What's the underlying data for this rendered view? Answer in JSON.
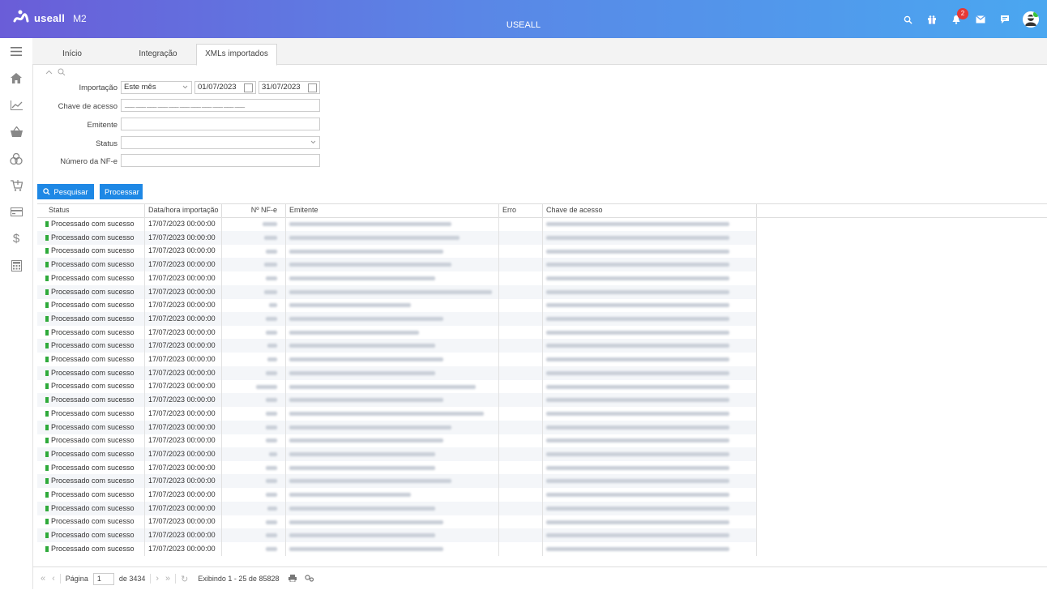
{
  "header": {
    "brand": "useall",
    "version": "M2",
    "title": "USEALL",
    "notification_count": "2",
    "icons": [
      "search-icon",
      "gift-icon",
      "bell-icon",
      "mail-icon",
      "chat-icon",
      "avatar"
    ]
  },
  "sidebar": {
    "items": [
      "menu-icon",
      "home-icon",
      "chart-icon",
      "basket-icon",
      "boxes-icon",
      "cart-icon",
      "card-icon",
      "dollar-icon",
      "calculator-icon"
    ]
  },
  "tabs": [
    {
      "label": "Início"
    },
    {
      "label": "Integração"
    },
    {
      "label": "XMLs importados",
      "active": true
    }
  ],
  "filters": {
    "importacao_label": "Importação",
    "importacao_value": "Este mês",
    "date_from": "01/07/2023",
    "date_to": "31/07/2023",
    "chave_label": "Chave de acesso",
    "chave_mask": "___ ___ ___ ___ ___ ___ ___ ___ ___ ___ ___",
    "emitente_label": "Emitente",
    "status_label": "Status",
    "numero_label": "Número da NF-e"
  },
  "actions": {
    "search_label": "Pesquisar",
    "process_label": "Processar"
  },
  "grid": {
    "columns": [
      "Status",
      "Data/hora importação",
      "Nº NF-e",
      "Emitente",
      "Erro",
      "Chave de acesso"
    ],
    "rows": [
      {
        "status": "Processado com sucesso",
        "date": "17/07/2023 00:00:00"
      },
      {
        "status": "Processado com sucesso",
        "date": "17/07/2023 00:00:00"
      },
      {
        "status": "Processado com sucesso",
        "date": "17/07/2023 00:00:00"
      },
      {
        "status": "Processado com sucesso",
        "date": "17/07/2023 00:00:00"
      },
      {
        "status": "Processado com sucesso",
        "date": "17/07/2023 00:00:00"
      },
      {
        "status": "Processado com sucesso",
        "date": "17/07/2023 00:00:00"
      },
      {
        "status": "Processado com sucesso",
        "date": "17/07/2023 00:00:00"
      },
      {
        "status": "Processado com sucesso",
        "date": "17/07/2023 00:00:00"
      },
      {
        "status": "Processado com sucesso",
        "date": "17/07/2023 00:00:00"
      },
      {
        "status": "Processado com sucesso",
        "date": "17/07/2023 00:00:00"
      },
      {
        "status": "Processado com sucesso",
        "date": "17/07/2023 00:00:00"
      },
      {
        "status": "Processado com sucesso",
        "date": "17/07/2023 00:00:00"
      },
      {
        "status": "Processado com sucesso",
        "date": "17/07/2023 00:00:00"
      },
      {
        "status": "Processado com sucesso",
        "date": "17/07/2023 00:00:00"
      },
      {
        "status": "Processado com sucesso",
        "date": "17/07/2023 00:00:00"
      },
      {
        "status": "Processado com sucesso",
        "date": "17/07/2023 00:00:00"
      },
      {
        "status": "Processado com sucesso",
        "date": "17/07/2023 00:00:00"
      },
      {
        "status": "Processado com sucesso",
        "date": "17/07/2023 00:00:00"
      },
      {
        "status": "Processado com sucesso",
        "date": "17/07/2023 00:00:00"
      },
      {
        "status": "Processado com sucesso",
        "date": "17/07/2023 00:00:00"
      },
      {
        "status": "Processado com sucesso",
        "date": "17/07/2023 00:00:00"
      },
      {
        "status": "Processado com sucesso",
        "date": "17/07/2023 00:00:00"
      },
      {
        "status": "Processado com sucesso",
        "date": "17/07/2023 00:00:00"
      },
      {
        "status": "Processado com sucesso",
        "date": "17/07/2023 00:00:00"
      },
      {
        "status": "Processado com sucesso",
        "date": "17/07/2023 00:00:00"
      }
    ]
  },
  "pager": {
    "page_label": "Página",
    "page_value": "1",
    "page_total": "de 3434",
    "summary": "Exibindo 1 - 25 de 85828"
  },
  "colors": {
    "primary": "#1e88e5",
    "success": "#2eaa3a",
    "badge": "#e53935"
  }
}
